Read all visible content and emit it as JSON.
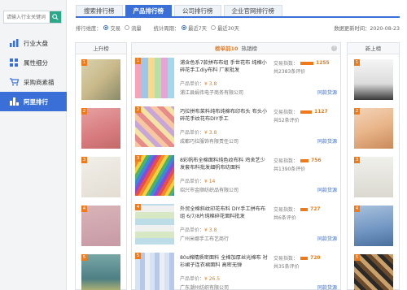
{
  "sidebar": {
    "search_placeholder": "请输入行业关键词",
    "items": [
      {
        "label": "行业大盘",
        "icon": "bar-chart-icon"
      },
      {
        "label": "属性细分",
        "icon": "grid-icon"
      },
      {
        "label": "采购商素描",
        "icon": "cart-icon"
      },
      {
        "label": "阿里排行",
        "icon": "ranking-icon",
        "active": true
      }
    ]
  },
  "tabs": [
    {
      "label": "搜索排行榜",
      "active": false
    },
    {
      "label": "产品排行榜",
      "active": true
    },
    {
      "label": "公司排行榜",
      "active": false
    },
    {
      "label": "企业官网排行榜",
      "active": false
    }
  ],
  "filters": {
    "dimension_label": "排行维度：",
    "dimension_options": [
      "交易",
      "流量"
    ],
    "dimension_selected": "交易",
    "period_label": "统计周期：",
    "period_options": [
      "最近7天",
      "最近30天"
    ],
    "period_selected": "最近7天",
    "update_text": "数据更新时间：2020-08-23"
  },
  "columns": {
    "left_title": "上升榜",
    "mid_title_hot": "榜单前10",
    "mid_title": "热销榜",
    "right_title": "新上榜"
  },
  "products": [
    {
      "rank": "1",
      "title": "浦含色系7款拼布布组 手世花布 纯棉小碎花手工diy布料 厂家批发",
      "price_label": "产品单价：",
      "price": "¥ 3.8",
      "seller": "浦江县娟伟电子商务有限公司",
      "index_label": "交易指数：",
      "index": "1255",
      "meta": "共2383条评价",
      "same": "同款货源"
    },
    {
      "rank": "2",
      "title": "巧拉拼布菜料纯布纯棉布印布头 布头小碎花手纹花布DIY手工",
      "price_label": "产品单价：",
      "price": "¥ 3.8",
      "seller": "成都巧拉服饰有限责任公司",
      "index_label": "交易指数：",
      "index": "1127",
      "meta": "共52条评价",
      "same": "同款货源"
    },
    {
      "rank": "3",
      "title": "8彩帆布全棉面料纯色纹布料 鸡舍艺少发套布料批发细帆布纺面料",
      "price_label": "产品单价：",
      "price": "¥ 14",
      "seller": "绍兴市金顺纺织品有限公司",
      "index_label": "交易指数：",
      "index": "756",
      "meta": "共1390条评价",
      "same": "同款货源"
    },
    {
      "rank": "4",
      "title": "外贸全棉斜纹印花布料 DIY手工拼布布组 6/7/8片纯棉碎花面料批发",
      "price_label": "产品单价：",
      "price": "¥ 3.8",
      "seller": "广州米娜手工布艺商行",
      "index_label": "交易指数：",
      "index": "727",
      "meta": "共6条评价",
      "same": "同款货源"
    },
    {
      "rank": "5",
      "title": "80s棉精质密面料 全棉加厚丝光棉布 衬衫裙子连衣裙面料 高密无弹",
      "price_label": "产品单价：",
      "price": "¥ 26.5",
      "seller": "广东潮州纺织有限公司",
      "index_label": "交易指数：",
      "index": "720",
      "meta": "共35条评价",
      "same": "同款货源"
    }
  ],
  "colors": {
    "accent": "#3a6fd7",
    "hot": "#f07a1a",
    "search": "#2aa889"
  }
}
